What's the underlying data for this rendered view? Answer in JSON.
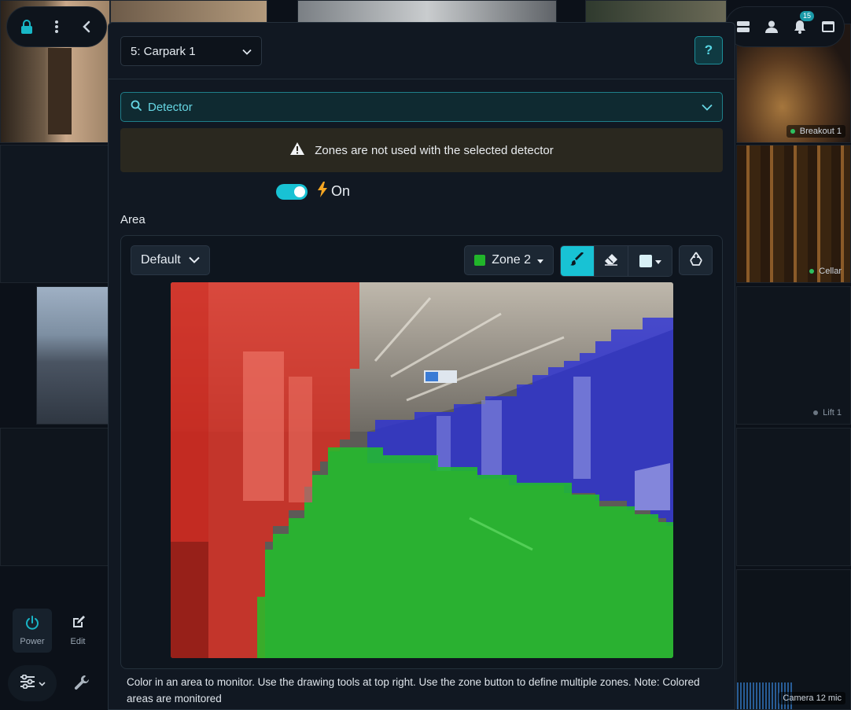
{
  "background": {
    "tiles": [
      {
        "label": "Breakout 1",
        "status": "online"
      },
      {
        "label": "Cellar",
        "status": "online"
      },
      {
        "label": "Lift 1",
        "status": "offline"
      },
      {
        "label": "Camera 12 mic",
        "status": "none"
      }
    ]
  },
  "top_left": {
    "icons": [
      "lock-icon",
      "more-vertical-icon",
      "chevron-left-icon"
    ]
  },
  "top_right": {
    "icons": [
      "layers-icon",
      "user-icon",
      "bell-icon",
      "window-icon"
    ],
    "notification_count": "15"
  },
  "bottom_left": {
    "power_label": "Power",
    "edit_label": "Edit"
  },
  "modal": {
    "camera_select": {
      "value": "5: Carpark 1"
    },
    "help_label": "?",
    "detector": {
      "label": "Detector"
    },
    "warning": {
      "text": "Zones are not used with the selected detector"
    },
    "toggle": {
      "state": "on",
      "label": "On"
    },
    "area_label": "Area",
    "area": {
      "preset": "Default",
      "zone": {
        "label": "Zone 2",
        "color": "#21b52a"
      },
      "tools": [
        "brush-icon",
        "eraser-icon",
        "color-picker",
        "recycle-icon"
      ],
      "active_tool": "brush",
      "zone_colors": {
        "zone1": "#e02a1f",
        "zone2": "#21b52a",
        "zone3": "#2a2fd9"
      }
    },
    "help_text": "Color in an area to monitor. Use the drawing tools at top right. Use the zone button to define multiple zones. Note: Colored areas are monitored"
  }
}
